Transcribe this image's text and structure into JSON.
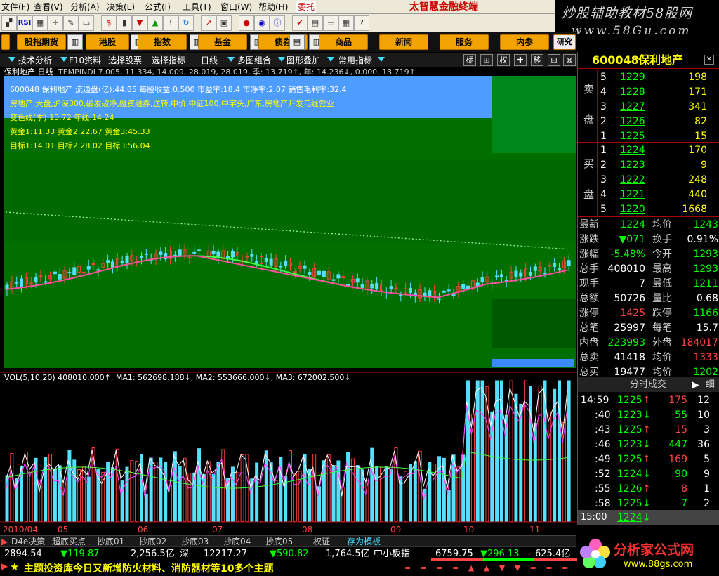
{
  "menu": {
    "items": [
      "文件(F)",
      "查看(V)",
      "分析(A)",
      "决策(L)",
      "公式(I)",
      "工具(T)",
      "窗口(W)",
      "帮助(H)"
    ],
    "tab_label": "委托",
    "brand": "太智慧金融终端"
  },
  "watermark": {
    "line1": "炒股辅助教材58股网",
    "line2": "www.58Gu.com"
  },
  "categories": [
    "股指期货",
    "港股",
    "指数",
    "基金",
    "债券",
    "商品",
    "新闻",
    "服务",
    "内参",
    "研究室"
  ],
  "subbar": {
    "items": [
      "技术分析",
      "F10资料",
      "选择股票",
      "选择指标",
      "日线",
      "多图组合",
      "图形叠加",
      "常用指标"
    ],
    "right_btns": [
      "标",
      "⊞",
      "权",
      "✚",
      "移",
      "⊡",
      "⊠"
    ]
  },
  "chart": {
    "header": "保利地产 日线",
    "indicator_line": "TEMPINDI 7.005, 11.334, 14.009, 28.019, 28.019, 季: 13.719↑, 年: 14.236↓, 0.000, 13.719↑",
    "info_lines": [
      "600048 保利地产   流通盘(亿):44.85 每股收益:0.500   市盈率:18.4   市净率:2.07   销售毛利率:32.4",
      "房地产,大盘,沪深300,破发破净,融资融券,送转,中价,中证100,中字头,广东,房地产开发与经营业",
      "变色线(季):13.72          年线:14.24",
      "黄金1:11.33   黄金2:22.67   黄金3:45.33",
      "目标1:14.01   目标2:28.02   目标3:56.04"
    ],
    "colors": {
      "bg_green": "#006f00",
      "bg_dark": "#004f00",
      "blue_panel": "#4d9cff",
      "up": "#ff4040",
      "down": "#55e0ff"
    }
  },
  "volume": {
    "header": "VOL(5,10,20) 408010.000↑, MA1: 562698.188↓, MA2: 553666.000↓, MA3: 672002.500↓",
    "months": [
      "2010/04",
      "05",
      "06",
      "07",
      "08",
      "09",
      "10",
      "11"
    ]
  },
  "right_panel": {
    "code": "600048",
    "name": "保利地产",
    "sell_label": [
      "卖",
      "盘"
    ],
    "buy_label": [
      "买",
      "盘"
    ],
    "sell": [
      {
        "lvl": "5",
        "price": "1229",
        "vol": "198"
      },
      {
        "lvl": "4",
        "price": "1228",
        "vol": "171"
      },
      {
        "lvl": "3",
        "price": "1227",
        "vol": "341"
      },
      {
        "lvl": "2",
        "price": "1226",
        "vol": "82"
      },
      {
        "lvl": "1",
        "price": "1225",
        "vol": "15"
      }
    ],
    "buy": [
      {
        "lvl": "1",
        "price": "1224",
        "vol": "170"
      },
      {
        "lvl": "2",
        "price": "1223",
        "vol": "9"
      },
      {
        "lvl": "3",
        "price": "1222",
        "vol": "248"
      },
      {
        "lvl": "4",
        "price": "1221",
        "vol": "440"
      },
      {
        "lvl": "5",
        "price": "1220",
        "vol": "1668"
      }
    ],
    "stats": [
      {
        "l1": "最新",
        "v1": "1224",
        "c1": "g",
        "l2": "均价",
        "v2": "1243",
        "c2": "g"
      },
      {
        "l1": "涨跌",
        "v1": "▼071",
        "c1": "g",
        "l2": "换手",
        "v2": "0.91%",
        "c2": "w"
      },
      {
        "l1": "涨幅",
        "v1": "-5.48%",
        "c1": "g",
        "l2": "今开",
        "v2": "1293",
        "c2": "g"
      },
      {
        "l1": "总手",
        "v1": "408010",
        "c1": "w",
        "l2": "最高",
        "v2": "1293",
        "c2": "g"
      },
      {
        "l1": "现手",
        "v1": "7",
        "c1": "w",
        "l2": "最低",
        "v2": "1211",
        "c2": "g"
      },
      {
        "l1": "总额",
        "v1": "50726",
        "c1": "w",
        "l2": "量比",
        "v2": "0.68",
        "c2": "w"
      },
      {
        "l1": "涨停",
        "v1": "1425",
        "c1": "r",
        "l2": "跌停",
        "v2": "1166",
        "c2": "g"
      },
      {
        "l1": "总笔",
        "v1": "25997",
        "c1": "w",
        "l2": "每笔",
        "v2": "15.7",
        "c2": "w"
      },
      {
        "l1": "内盘",
        "v1": "223993",
        "c1": "g",
        "l2": "外盘",
        "v2": "184017",
        "c2": "r"
      },
      {
        "l1": "总卖",
        "v1": "41418",
        "c1": "w",
        "l2": "均价",
        "v2": "1333",
        "c2": "r"
      },
      {
        "l1": "总买",
        "v1": "19477",
        "c1": "w",
        "l2": "均价",
        "v2": "1202",
        "c2": "g"
      }
    ],
    "ticks_title": "分时成交",
    "ticks_btn": "细",
    "ticks": [
      {
        "t": "14:59",
        "p": "1225",
        "a": "↑",
        "v": "175",
        "n": "12",
        "ac": "r"
      },
      {
        "t": ":40",
        "p": "1223",
        "a": "↓",
        "v": "55",
        "n": "10",
        "ac": "g"
      },
      {
        "t": ":43",
        "p": "1225",
        "a": "↑",
        "v": "15",
        "n": "3",
        "ac": "r"
      },
      {
        "t": ":46",
        "p": "1223",
        "a": "↓",
        "v": "447",
        "n": "36",
        "ac": "g"
      },
      {
        "t": ":49",
        "p": "1225",
        "a": "↑",
        "v": "169",
        "n": "5",
        "ac": "r"
      },
      {
        "t": ":52",
        "p": "1224",
        "a": "↓",
        "v": "90",
        "n": "9",
        "ac": "g"
      },
      {
        "t": ":55",
        "p": "1226",
        "a": "↑",
        "v": "8",
        "n": "1",
        "ac": "r"
      },
      {
        "t": ":58",
        "p": "1225",
        "a": "↓",
        "v": "7",
        "n": "2",
        "ac": "g"
      }
    ],
    "close_time": "15:00",
    "close_price": "1224"
  },
  "tabs": [
    "D4e决策",
    "超底买点",
    "抄底01",
    "抄底02",
    "抄底03",
    "抄底04",
    "抄底05",
    "权证",
    "存为模板"
  ],
  "status": {
    "sh_index": "2894.54",
    "sh_chg": "▼119.87",
    "sh_amt": "2,256.5亿",
    "sz_lbl": "深",
    "sz_index": "12217.27",
    "sz_chg": "▼590.82",
    "sz_amt": "1,764.5亿",
    "sme_lbl": "中小板指",
    "sme_index": "6759.75",
    "sme_chg": "▼296.13",
    "sme_amt": "625.4亿"
  },
  "news": "主题投资库今日又新增防火材料、消防器材等10多个主题",
  "bottom_brand": {
    "line1": "分析家公式网",
    "line2": "www.88gs.com"
  }
}
